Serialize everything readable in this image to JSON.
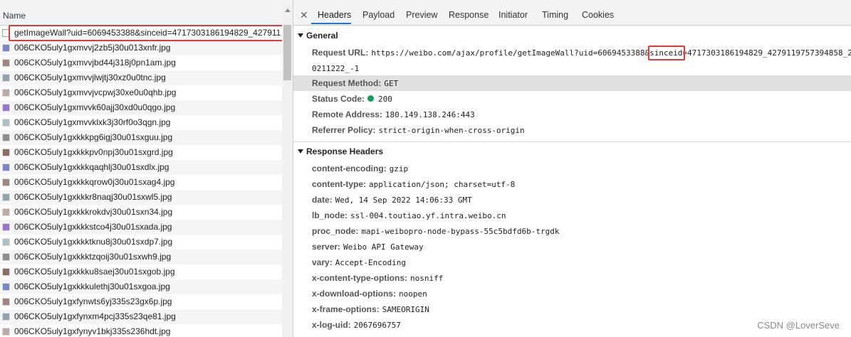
{
  "left_panel": {
    "column_header": "Name",
    "requests": [
      {
        "name": "getImageWall?uid=6069453388&sinceid=4717303186194829_427911",
        "type": "document"
      },
      {
        "name": "006CKO5uly1gxmvvj2zb5j30u013xnfr.jpg",
        "type": "image"
      },
      {
        "name": "006CKO5uly1gxmvvjbd44j318j0pn1am.jpg",
        "type": "image"
      },
      {
        "name": "006CKO5uly1gxmvvjlwjtj30xz0u0tnc.jpg",
        "type": "image"
      },
      {
        "name": "006CKO5uly1gxmvvjvcpwj30xe0u0qhb.jpg",
        "type": "image"
      },
      {
        "name": "006CKO5uly1gxmvvk60ajj30xd0u0qgo.jpg",
        "type": "image"
      },
      {
        "name": "006CKO5uly1gxmvvklxk3j30rf0o3qgn.jpg",
        "type": "image"
      },
      {
        "name": "006CKO5uly1gxkkkpg6igj30u01sxguu.jpg",
        "type": "image"
      },
      {
        "name": "006CKO5uly1gxkkkpv0npj30u01sxgrd.jpg",
        "type": "image"
      },
      {
        "name": "006CKO5uly1gxkkkqaqhlj30u01sxdlx.jpg",
        "type": "image"
      },
      {
        "name": "006CKO5uly1gxkkkqrow0j30u01sxag4.jpg",
        "type": "image"
      },
      {
        "name": "006CKO5uly1gxkkkr8naqj30u01sxwl5.jpg",
        "type": "image"
      },
      {
        "name": "006CKO5uly1gxkkkrokdvj30u01sxn34.jpg",
        "type": "image"
      },
      {
        "name": "006CKO5uly1gxkkkstco4j30u01sxada.jpg",
        "type": "image"
      },
      {
        "name": "006CKO5uly1gxkkktknu8j30u01sxdp7.jpg",
        "type": "image"
      },
      {
        "name": "006CKO5uly1gxkkktzqoij30u01sxwh9.jpg",
        "type": "image"
      },
      {
        "name": "006CKO5uly1gxkkku8saej30u01sxgob.jpg",
        "type": "image"
      },
      {
        "name": "006CKO5uly1gxkkkulethj30u01sxgoa.jpg",
        "type": "image"
      },
      {
        "name": "006CKO5uly1gxfynwts6yj335s23gx6p.jpg",
        "type": "image"
      },
      {
        "name": "006CKO5uly1gxfynxm4pcj335s23qe81.jpg",
        "type": "image"
      },
      {
        "name": "006CKO5uly1gxfynyv1bkj335s236hdt.jpg",
        "type": "image"
      }
    ]
  },
  "tabs": [
    "Headers",
    "Payload",
    "Preview",
    "Response",
    "Initiator",
    "Timing",
    "Cookies"
  ],
  "active_tab": "Headers",
  "close_icon": "close-icon",
  "general": {
    "title": "General",
    "request_url_label": "Request URL:",
    "request_url_line1": "https://weibo.com/ajax/profile/getImageWall?uid=6069453388&sinceid=4717303186194829_4279119757394858_2",
    "request_url_line2": "0211222_-1",
    "request_method_label": "Request Method:",
    "request_method": "GET",
    "status_code_label": "Status Code:",
    "status_code": "200",
    "status_color": "#0f9d58",
    "remote_address_label": "Remote Address:",
    "remote_address": "180.149.138.246:443",
    "referrer_policy_label": "Referrer Policy:",
    "referrer_policy": "strict-origin-when-cross-origin"
  },
  "response_headers": {
    "title": "Response Headers",
    "items": [
      {
        "key": "content-encoding:",
        "value": "gzip"
      },
      {
        "key": "content-type:",
        "value": "application/json; charset=utf-8"
      },
      {
        "key": "date:",
        "value": "Wed, 14 Sep 2022 14:06:33 GMT"
      },
      {
        "key": "lb_node:",
        "value": "ssl-004.toutiao.yf.intra.weibo.cn"
      },
      {
        "key": "proc_node:",
        "value": "mapi-weibopro-node-bypass-55c5bdfd6b-trgdk"
      },
      {
        "key": "server:",
        "value": "Weibo API Gateway"
      },
      {
        "key": "vary:",
        "value": "Accept-Encoding"
      },
      {
        "key": "x-content-type-options:",
        "value": "nosniff"
      },
      {
        "key": "x-download-options:",
        "value": "noopen"
      },
      {
        "key": "x-frame-options:",
        "value": "SAMEORIGIN"
      },
      {
        "key": "x-log-uid:",
        "value": "2067696757"
      }
    ]
  },
  "watermark": "CSDN @LoverSeve",
  "highlight_color": "#e53935"
}
